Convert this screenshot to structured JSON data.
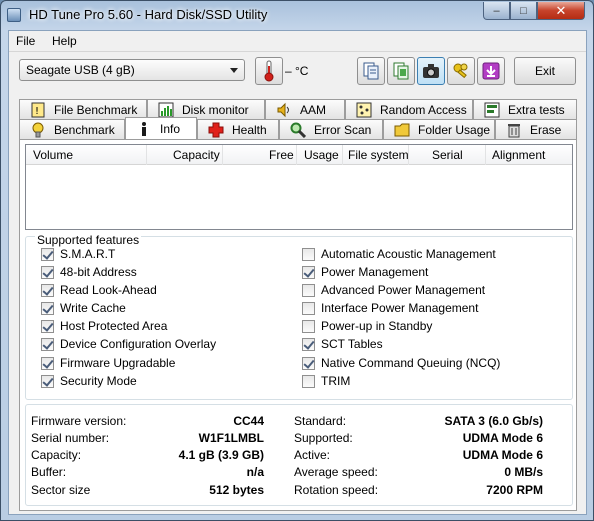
{
  "window": {
    "title": "HD Tune Pro 5.60 - Hard Disk/SSD Utility",
    "minimize_glyph": "–",
    "maximize_glyph": "□",
    "close_glyph": "✕"
  },
  "menu": {
    "file": "File",
    "help": "Help"
  },
  "toolbar": {
    "drive_selected": "Seagate USB (4 gB)",
    "temperature": "– °C",
    "exit_label": "Exit",
    "icons": [
      "thermometer-icon",
      "copy-text-icon",
      "copy-info-icon",
      "screenshot-camera-icon",
      "options-keys-icon",
      "save-download-icon"
    ]
  },
  "tabs": {
    "row1": [
      {
        "label": "File Benchmark",
        "icon": "file-benchmark-icon"
      },
      {
        "label": "Disk monitor",
        "icon": "disk-monitor-icon"
      },
      {
        "label": "AAM",
        "icon": "speaker-icon"
      },
      {
        "label": "Random Access",
        "icon": "random-access-icon"
      },
      {
        "label": "Extra tests",
        "icon": "extra-tests-icon"
      }
    ],
    "row2": [
      {
        "label": "Benchmark",
        "icon": "benchmark-icon"
      },
      {
        "label": "Info",
        "icon": "info-icon"
      },
      {
        "label": "Health",
        "icon": "health-cross-icon"
      },
      {
        "label": "Error Scan",
        "icon": "magnifier-icon"
      },
      {
        "label": "Folder Usage",
        "icon": "folder-icon"
      },
      {
        "label": "Erase",
        "icon": "trash-icon"
      }
    ],
    "selected": "Info"
  },
  "volume_table": {
    "columns": [
      "Volume",
      "Capacity",
      "Free",
      "Usage",
      "File system",
      "Serial",
      "Alignment"
    ]
  },
  "features": {
    "title": "Supported features",
    "left": [
      {
        "label": "S.M.A.R.T",
        "checked": true
      },
      {
        "label": "48-bit Address",
        "checked": true
      },
      {
        "label": "Read Look-Ahead",
        "checked": true
      },
      {
        "label": "Write Cache",
        "checked": true
      },
      {
        "label": "Host Protected Area",
        "checked": true
      },
      {
        "label": "Device Configuration Overlay",
        "checked": true
      },
      {
        "label": "Firmware Upgradable",
        "checked": true
      },
      {
        "label": "Security Mode",
        "checked": true
      }
    ],
    "right": [
      {
        "label": "Automatic Acoustic Management",
        "checked": false
      },
      {
        "label": "Power Management",
        "checked": true
      },
      {
        "label": "Advanced Power Management",
        "checked": false
      },
      {
        "label": "Interface Power Management",
        "checked": false
      },
      {
        "label": "Power-up in Standby",
        "checked": false
      },
      {
        "label": "SCT Tables",
        "checked": true
      },
      {
        "label": "Native Command Queuing (NCQ)",
        "checked": true
      },
      {
        "label": "TRIM",
        "checked": false
      }
    ]
  },
  "details": {
    "left": [
      {
        "label": "Firmware version:",
        "value": "CC44"
      },
      {
        "label": "Serial number:",
        "value": "W1F1LMBL"
      },
      {
        "label": "Capacity:",
        "value": "4.1 gB (3.9 GB)"
      },
      {
        "label": "Buffer:",
        "value": "n/a"
      },
      {
        "label": "Sector size",
        "value": "512 bytes"
      }
    ],
    "right": [
      {
        "label": "Standard:",
        "value": "SATA 3 (6.0 Gb/s)"
      },
      {
        "label": "Supported:",
        "value": "UDMA Mode 6"
      },
      {
        "label": "Active:",
        "value": "UDMA Mode 6"
      },
      {
        "label": "Average speed:",
        "value": "0 MB/s"
      },
      {
        "label": "Rotation speed:",
        "value": "7200 RPM"
      }
    ]
  }
}
